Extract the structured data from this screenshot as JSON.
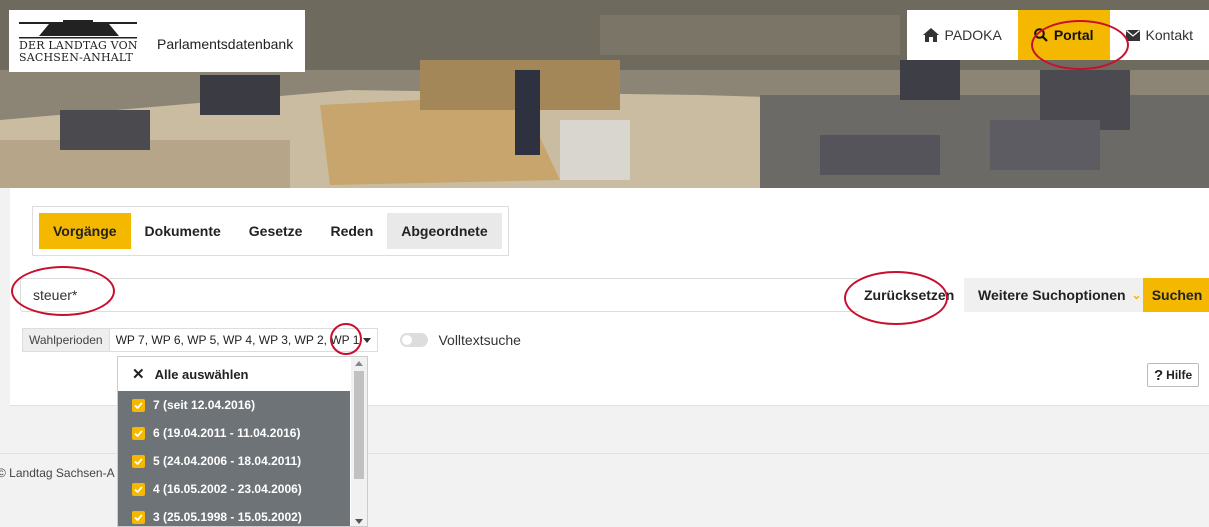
{
  "header": {
    "logo_line1": "DER LANDTAG VON",
    "logo_line2": "SACHSEN-ANHALT",
    "site_title": "Parlamentsdatenbank",
    "nav": [
      {
        "label": "PADOKA",
        "icon": "home-icon",
        "active": false
      },
      {
        "label": "Portal",
        "icon": "search-icon",
        "active": true
      },
      {
        "label": "Kontakt",
        "icon": "envelope-icon",
        "active": false
      }
    ]
  },
  "tabs": [
    {
      "label": "Vorgänge",
      "active": true
    },
    {
      "label": "Dokumente",
      "active": false
    },
    {
      "label": "Gesetze",
      "active": false
    },
    {
      "label": "Reden",
      "active": false
    },
    {
      "label": "Abgeordnete",
      "active": false
    }
  ],
  "search": {
    "value": "steuer*",
    "reset_label": "Zurücksetzen",
    "options_label": "Weitere Suchoptionen",
    "submit_label": "Suchen"
  },
  "filter": {
    "label": "Wahlperioden",
    "selected": "WP 7, WP 6, WP 5, WP 4, WP 3, WP 2, WP 1",
    "fulltext_label": "Volltextsuche"
  },
  "help_label": "Hilfe",
  "footer_text": "© Landtag Sachsen-A",
  "dropdown": {
    "select_all": "Alle auswählen",
    "items": [
      {
        "label": "7 (seit 12.04.2016)",
        "checked": true
      },
      {
        "label": "6 (19.04.2011 - 11.04.2016)",
        "checked": true
      },
      {
        "label": "5 (24.04.2006 - 18.04.2011)",
        "checked": true
      },
      {
        "label": "4 (16.05.2002 - 23.04.2006)",
        "checked": true
      },
      {
        "label": "3 (25.05.1998 - 15.05.2002)",
        "checked": true
      }
    ]
  },
  "colors": {
    "accent": "#f4b800",
    "highlight_circle": "#c8102e",
    "dropdown_item_bg": "#6d7377"
  }
}
